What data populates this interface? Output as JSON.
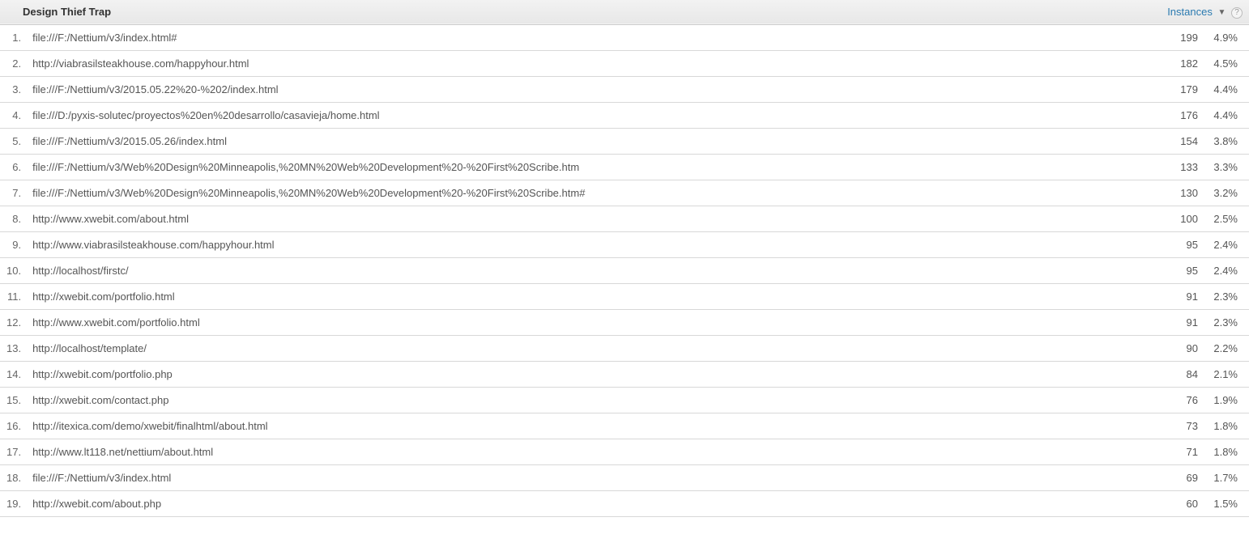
{
  "header": {
    "title": "Design Thief Trap",
    "instances_label": "Instances",
    "help_glyph": "?"
  },
  "rows": [
    {
      "rank": "1.",
      "url": "file:///F:/Nettium/v3/index.html#",
      "instances": "199",
      "percent": "4.9%"
    },
    {
      "rank": "2.",
      "url": "http://viabrasilsteakhouse.com/happyhour.html",
      "instances": "182",
      "percent": "4.5%"
    },
    {
      "rank": "3.",
      "url": "file:///F:/Nettium/v3/2015.05.22%20-%202/index.html",
      "instances": "179",
      "percent": "4.4%"
    },
    {
      "rank": "4.",
      "url": "file:///D:/pyxis-solutec/proyectos%20en%20desarrollo/casavieja/home.html",
      "instances": "176",
      "percent": "4.4%"
    },
    {
      "rank": "5.",
      "url": "file:///F:/Nettium/v3/2015.05.26/index.html",
      "instances": "154",
      "percent": "3.8%"
    },
    {
      "rank": "6.",
      "url": "file:///F:/Nettium/v3/Web%20Design%20Minneapolis,%20MN%20Web%20Development%20-%20First%20Scribe.htm",
      "instances": "133",
      "percent": "3.3%"
    },
    {
      "rank": "7.",
      "url": "file:///F:/Nettium/v3/Web%20Design%20Minneapolis,%20MN%20Web%20Development%20-%20First%20Scribe.htm#",
      "instances": "130",
      "percent": "3.2%"
    },
    {
      "rank": "8.",
      "url": "http://www.xwebit.com/about.html",
      "instances": "100",
      "percent": "2.5%"
    },
    {
      "rank": "9.",
      "url": "http://www.viabrasilsteakhouse.com/happyhour.html",
      "instances": "95",
      "percent": "2.4%"
    },
    {
      "rank": "10.",
      "url": "http://localhost/firstc/",
      "instances": "95",
      "percent": "2.4%"
    },
    {
      "rank": "11.",
      "url": "http://xwebit.com/portfolio.html",
      "instances": "91",
      "percent": "2.3%"
    },
    {
      "rank": "12.",
      "url": "http://www.xwebit.com/portfolio.html",
      "instances": "91",
      "percent": "2.3%"
    },
    {
      "rank": "13.",
      "url": "http://localhost/template/",
      "instances": "90",
      "percent": "2.2%"
    },
    {
      "rank": "14.",
      "url": "http://xwebit.com/portfolio.php",
      "instances": "84",
      "percent": "2.1%"
    },
    {
      "rank": "15.",
      "url": "http://xwebit.com/contact.php",
      "instances": "76",
      "percent": "1.9%"
    },
    {
      "rank": "16.",
      "url": "http://itexica.com/demo/xwebit/finalhtml/about.html",
      "instances": "73",
      "percent": "1.8%"
    },
    {
      "rank": "17.",
      "url": "http://www.lt118.net/nettium/about.html",
      "instances": "71",
      "percent": "1.8%"
    },
    {
      "rank": "18.",
      "url": "file:///F:/Nettium/v3/index.html",
      "instances": "69",
      "percent": "1.7%"
    },
    {
      "rank": "19.",
      "url": "http://xwebit.com/about.php",
      "instances": "60",
      "percent": "1.5%"
    }
  ]
}
